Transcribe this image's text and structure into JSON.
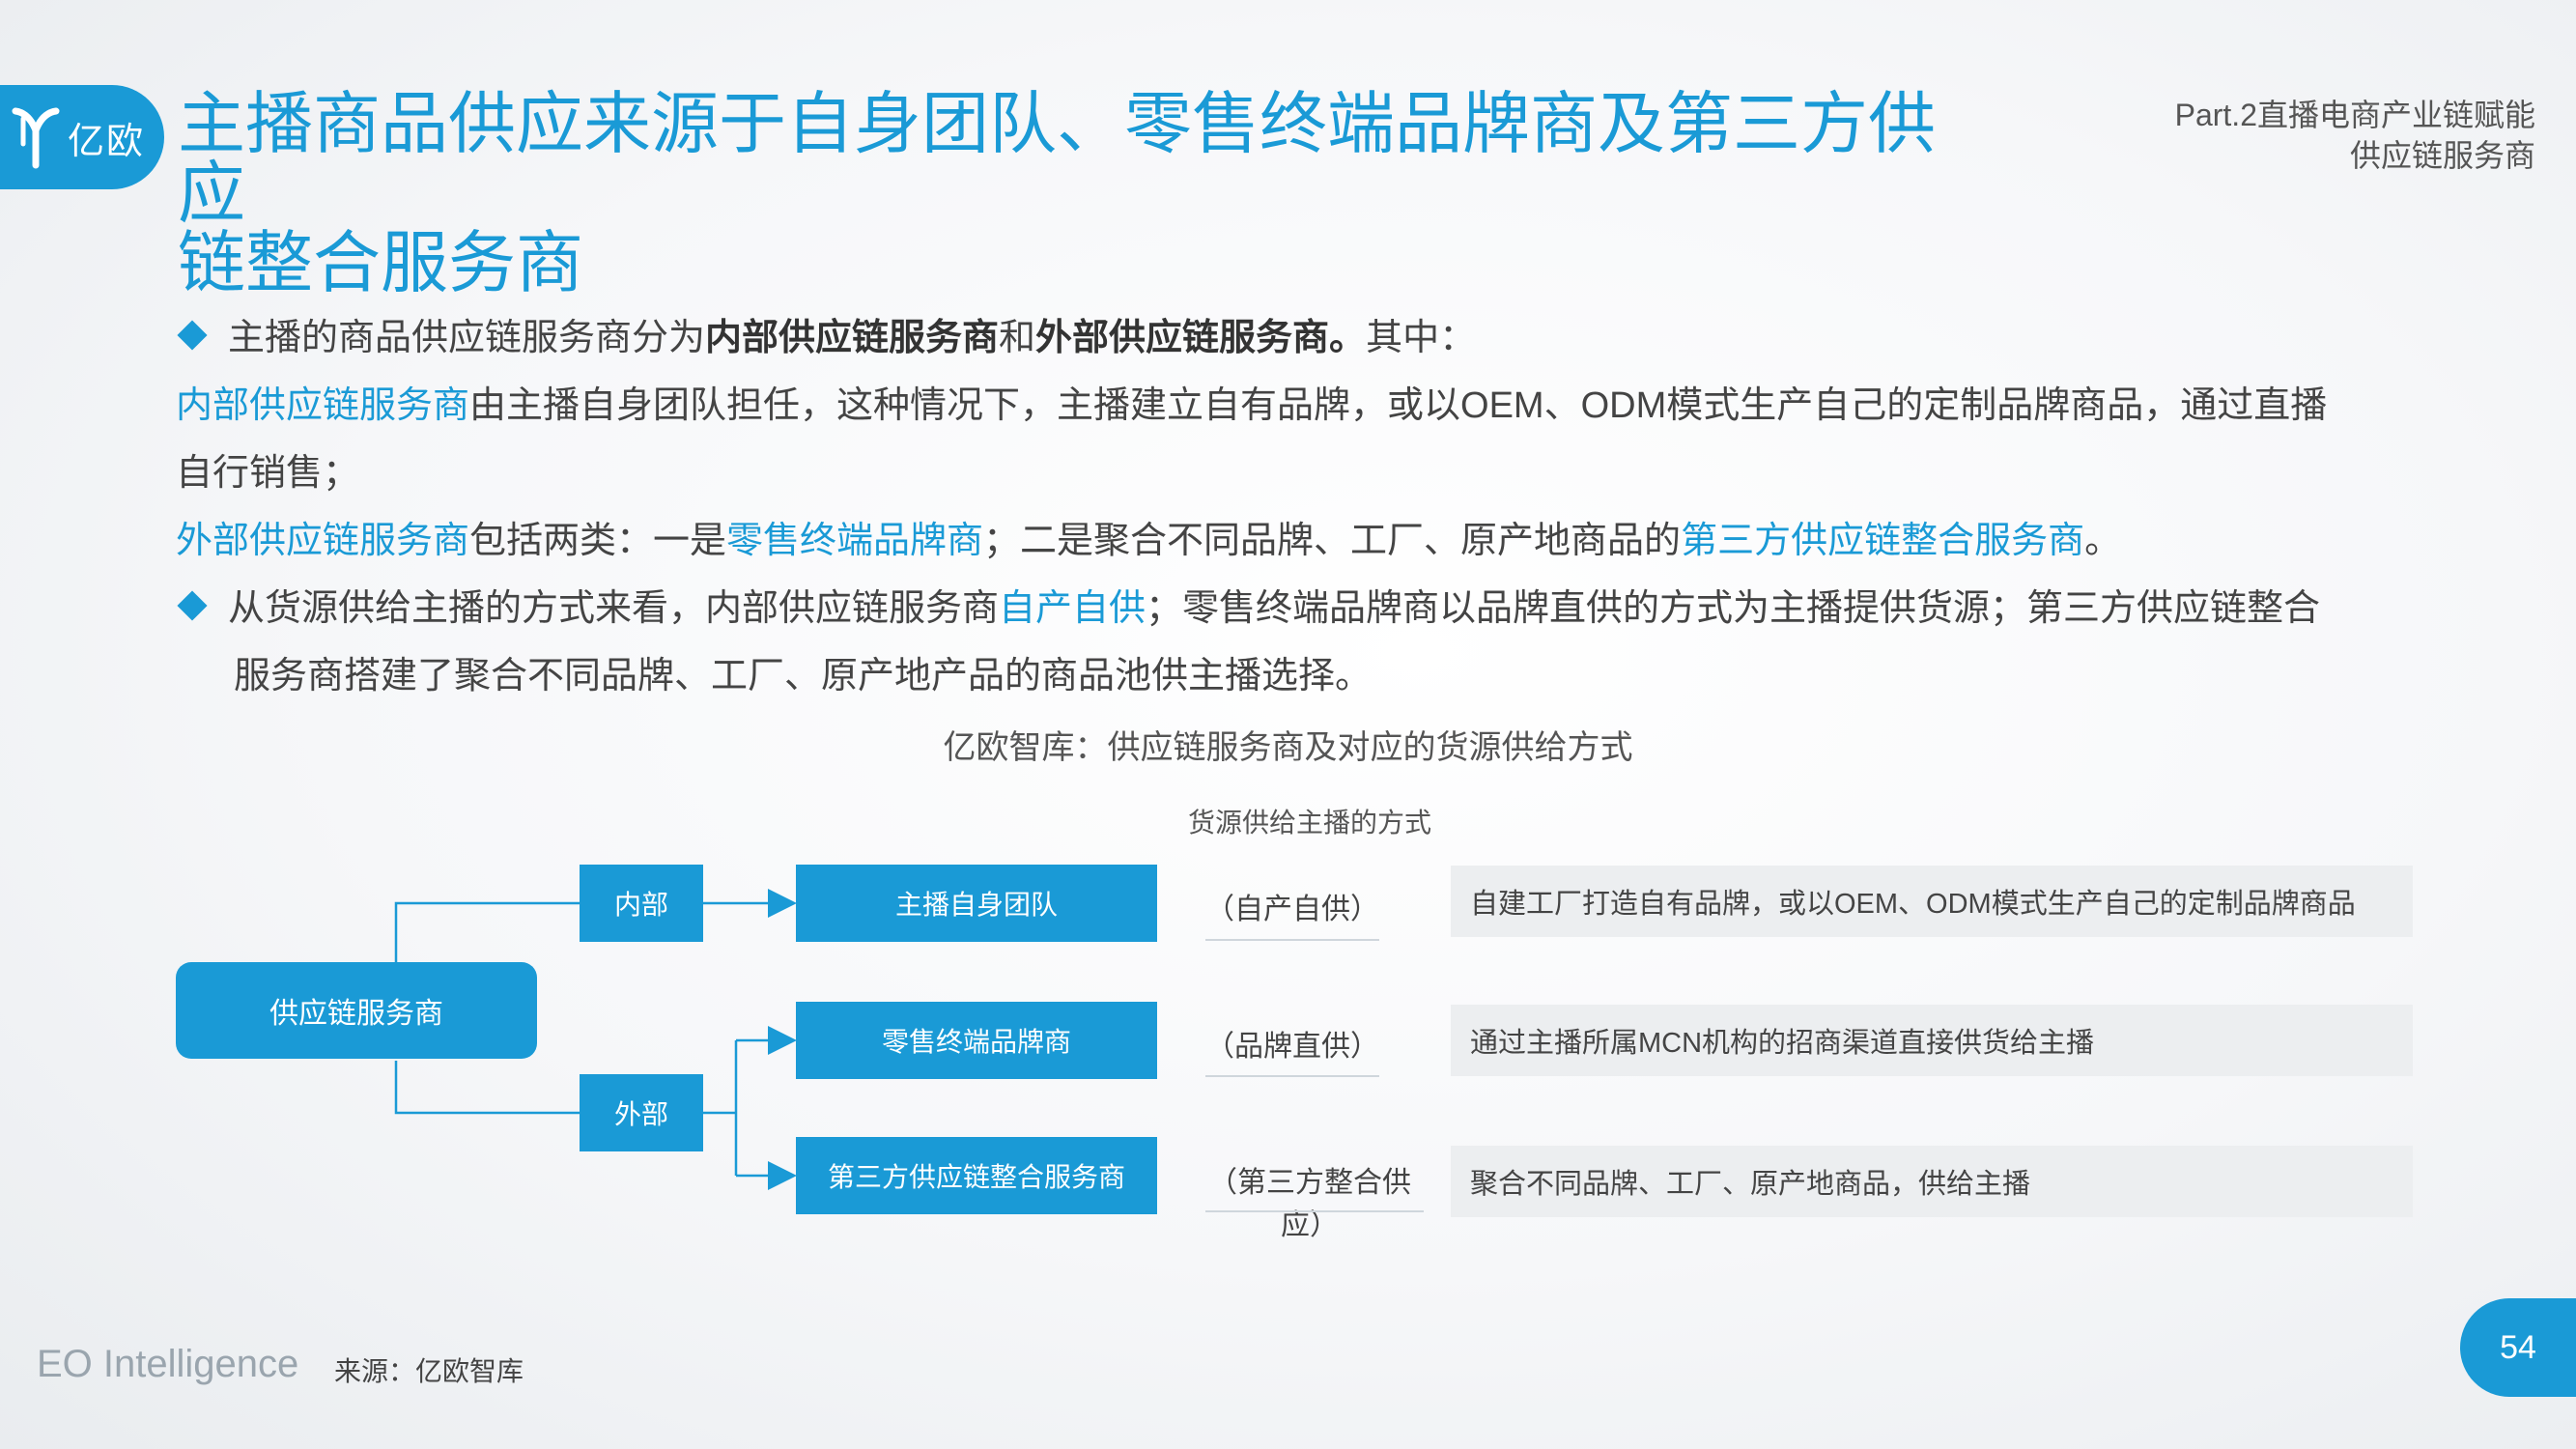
{
  "logo": {
    "text": "亿欧"
  },
  "header": {
    "title_line1": "主播商品供应来源于自身团队、零售终端品牌商及第三方供应",
    "title_line2": "链整合服务商",
    "part": "Part.2直播电商产业链赋能",
    "section": "供应链服务商"
  },
  "body": {
    "p1": {
      "a": "主播的商品供应链服务商分为",
      "b": "内部供应链服务商",
      "c": "和",
      "d": "外部供应链服务商。",
      "e": "其中："
    },
    "p2": {
      "a": "内部供应链服务商",
      "b": "由主播自身团队担任，这种情况下，主播建立自有品牌，或以OEM、ODM模式生产自己的定制品牌商品，通过直播"
    },
    "p3": {
      "a": "自行销售；"
    },
    "p4": {
      "a": "外部供应链服务商",
      "b": "包括两类：一是",
      "c": "零售终端品牌商",
      "d": "；二是聚合不同品牌、工厂、原产地商品的",
      "e": "第三方供应链整合服务商",
      "f": "。"
    },
    "p5": {
      "a": "从货源供给主播的方式来看，内部供应链服务商",
      "b": "自产自供",
      "c": "；零售终端品牌商以品牌直供的方式为主播提供货源；第三方供应链整合"
    },
    "p6": {
      "a": "服务商搭建了聚合不同品牌、工厂、原产地产品的商品池供主播选择。"
    }
  },
  "diagram": {
    "title": "亿欧智库：供应链服务商及对应的货源供给方式",
    "column_header": "货源供给主播的方式",
    "root": "供应链服务商",
    "internal": "内部",
    "external": "外部",
    "rows": [
      {
        "provider": "主播自身团队",
        "mode": "（自产自供）",
        "desc": "自建工厂打造自有品牌，或以OEM、ODM模式生产自己的定制品牌商品"
      },
      {
        "provider": "零售终端品牌商",
        "mode": "（品牌直供）",
        "desc": "通过主播所属MCN机构的招商渠道直接供货给主播"
      },
      {
        "provider": "第三方供应链整合服务商",
        "mode": "（第三方整合供应）",
        "desc": "聚合不同品牌、工厂、原产地商品，供给主播"
      }
    ]
  },
  "footer": {
    "brand": "EO Intelligence",
    "source": "来源：亿欧智库",
    "page": "54"
  },
  "colors": {
    "accent": "#1a9ad6",
    "text": "#444444",
    "desc_bg": "#eceef0"
  }
}
